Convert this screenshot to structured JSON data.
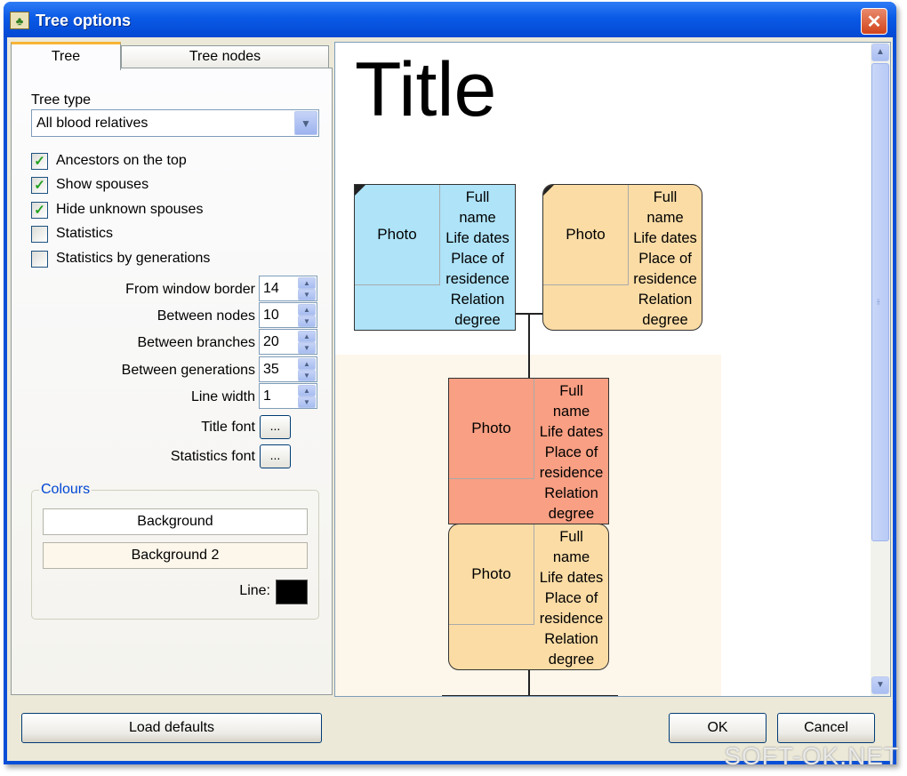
{
  "window": {
    "title": "Tree options",
    "close_label": "✕"
  },
  "tabs": [
    {
      "label": "Tree"
    },
    {
      "label": "Tree nodes"
    }
  ],
  "tree_type": {
    "label": "Tree type",
    "value": "All blood relatives"
  },
  "checkboxes": [
    {
      "label": "Ancestors on the top",
      "checked": true
    },
    {
      "label": "Show spouses",
      "checked": true
    },
    {
      "label": "Hide unknown spouses",
      "checked": true
    },
    {
      "label": "Statistics",
      "checked": false
    },
    {
      "label": "Statistics by generations",
      "checked": false
    }
  ],
  "spinners": [
    {
      "label": "From window border",
      "value": "14"
    },
    {
      "label": "Between nodes",
      "value": "10"
    },
    {
      "label": "Between branches",
      "value": "20"
    },
    {
      "label": "Between generations",
      "value": "35"
    },
    {
      "label": "Line width",
      "value": "1"
    }
  ],
  "fonts": {
    "title_font_label": "Title font",
    "statistics_font_label": "Statistics font",
    "ellipsis": "..."
  },
  "colours": {
    "group_label": "Colours",
    "background_label": "Background",
    "background2_label": "Background 2",
    "line_label": "Line:",
    "background_color": "#ffffff",
    "background2_color": "#fdf6ea",
    "line_color": "#000000"
  },
  "preview": {
    "title": "Title",
    "node": {
      "photo": "Photo",
      "lines": [
        "Full",
        "name",
        "Life dates",
        "Place of",
        "residence",
        "Relation",
        "degree"
      ]
    },
    "node_colors": {
      "blue": "#aee3f8",
      "peach": "#fbdca5",
      "salmon": "#f99f83"
    }
  },
  "buttons": {
    "load_defaults": "Load defaults",
    "ok": "OK",
    "cancel": "Cancel"
  },
  "watermark": "SOFT-OK.NET"
}
